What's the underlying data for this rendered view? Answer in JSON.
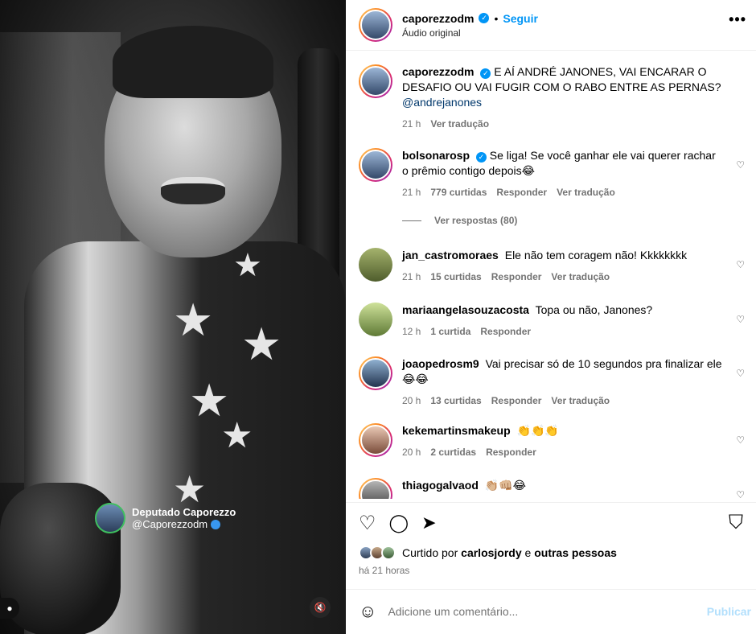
{
  "video": {
    "overlay_name": "Deputado Caporezzo",
    "overlay_handle": "@Caporezzodm"
  },
  "post": {
    "author": "caporezzodm",
    "follow_label": "Seguir",
    "separator": "•",
    "audio": "Áudio original",
    "more_label": "•••"
  },
  "caption": {
    "user": "caporezzodm",
    "text": "E AÍ ANDRÉ JANONES, VAI ENCARAR O DESAFIO OU VAI FUGIR COM O RABO ENTRE AS PERNAS?",
    "mention": "@andrejanones",
    "time": "21 h",
    "translate": "Ver tradução"
  },
  "comments": [
    {
      "user": "bolsonarosp",
      "verified": true,
      "text": "Se liga! Se você ganhar ele vai querer rachar o prêmio contigo depois😂",
      "time": "21 h",
      "likes": "779 curtidas",
      "reply": "Responder",
      "translate": "Ver tradução",
      "view_replies": "Ver respostas (80)"
    },
    {
      "user": "jan_castromoraes",
      "text": "Ele não tem coragem não! Kkkkkkkk",
      "time": "21 h",
      "likes": "15 curtidas",
      "reply": "Responder",
      "translate": "Ver tradução"
    },
    {
      "user": "mariaangelasouzacosta",
      "text": "Topa ou não, Janones?",
      "time": "12 h",
      "likes": "1 curtida",
      "reply": "Responder"
    },
    {
      "user": "joaopedrosm9",
      "text": "Vai precisar só de 10 segundos pra finalizar ele 😂😂",
      "time": "20 h",
      "likes": "13 curtidas",
      "reply": "Responder",
      "translate": "Ver tradução"
    },
    {
      "user": "kekemartinsmakeup",
      "text": "👏👏👏",
      "time": "20 h",
      "likes": "2 curtidas",
      "reply": "Responder"
    },
    {
      "user": "thiagogalvaod",
      "text": "👏🏼👊🏼😂"
    }
  ],
  "likes": {
    "prefix": "Curtido por",
    "user": "carlosjordy",
    "conj": "e",
    "others": "outras pessoas"
  },
  "time_ago": "há 21 horas",
  "add_comment": {
    "placeholder": "Adicione um comentário...",
    "publish": "Publicar"
  },
  "icons": {
    "heart": "♡",
    "comment": "◯",
    "share": "➤",
    "save": "⛉"
  }
}
